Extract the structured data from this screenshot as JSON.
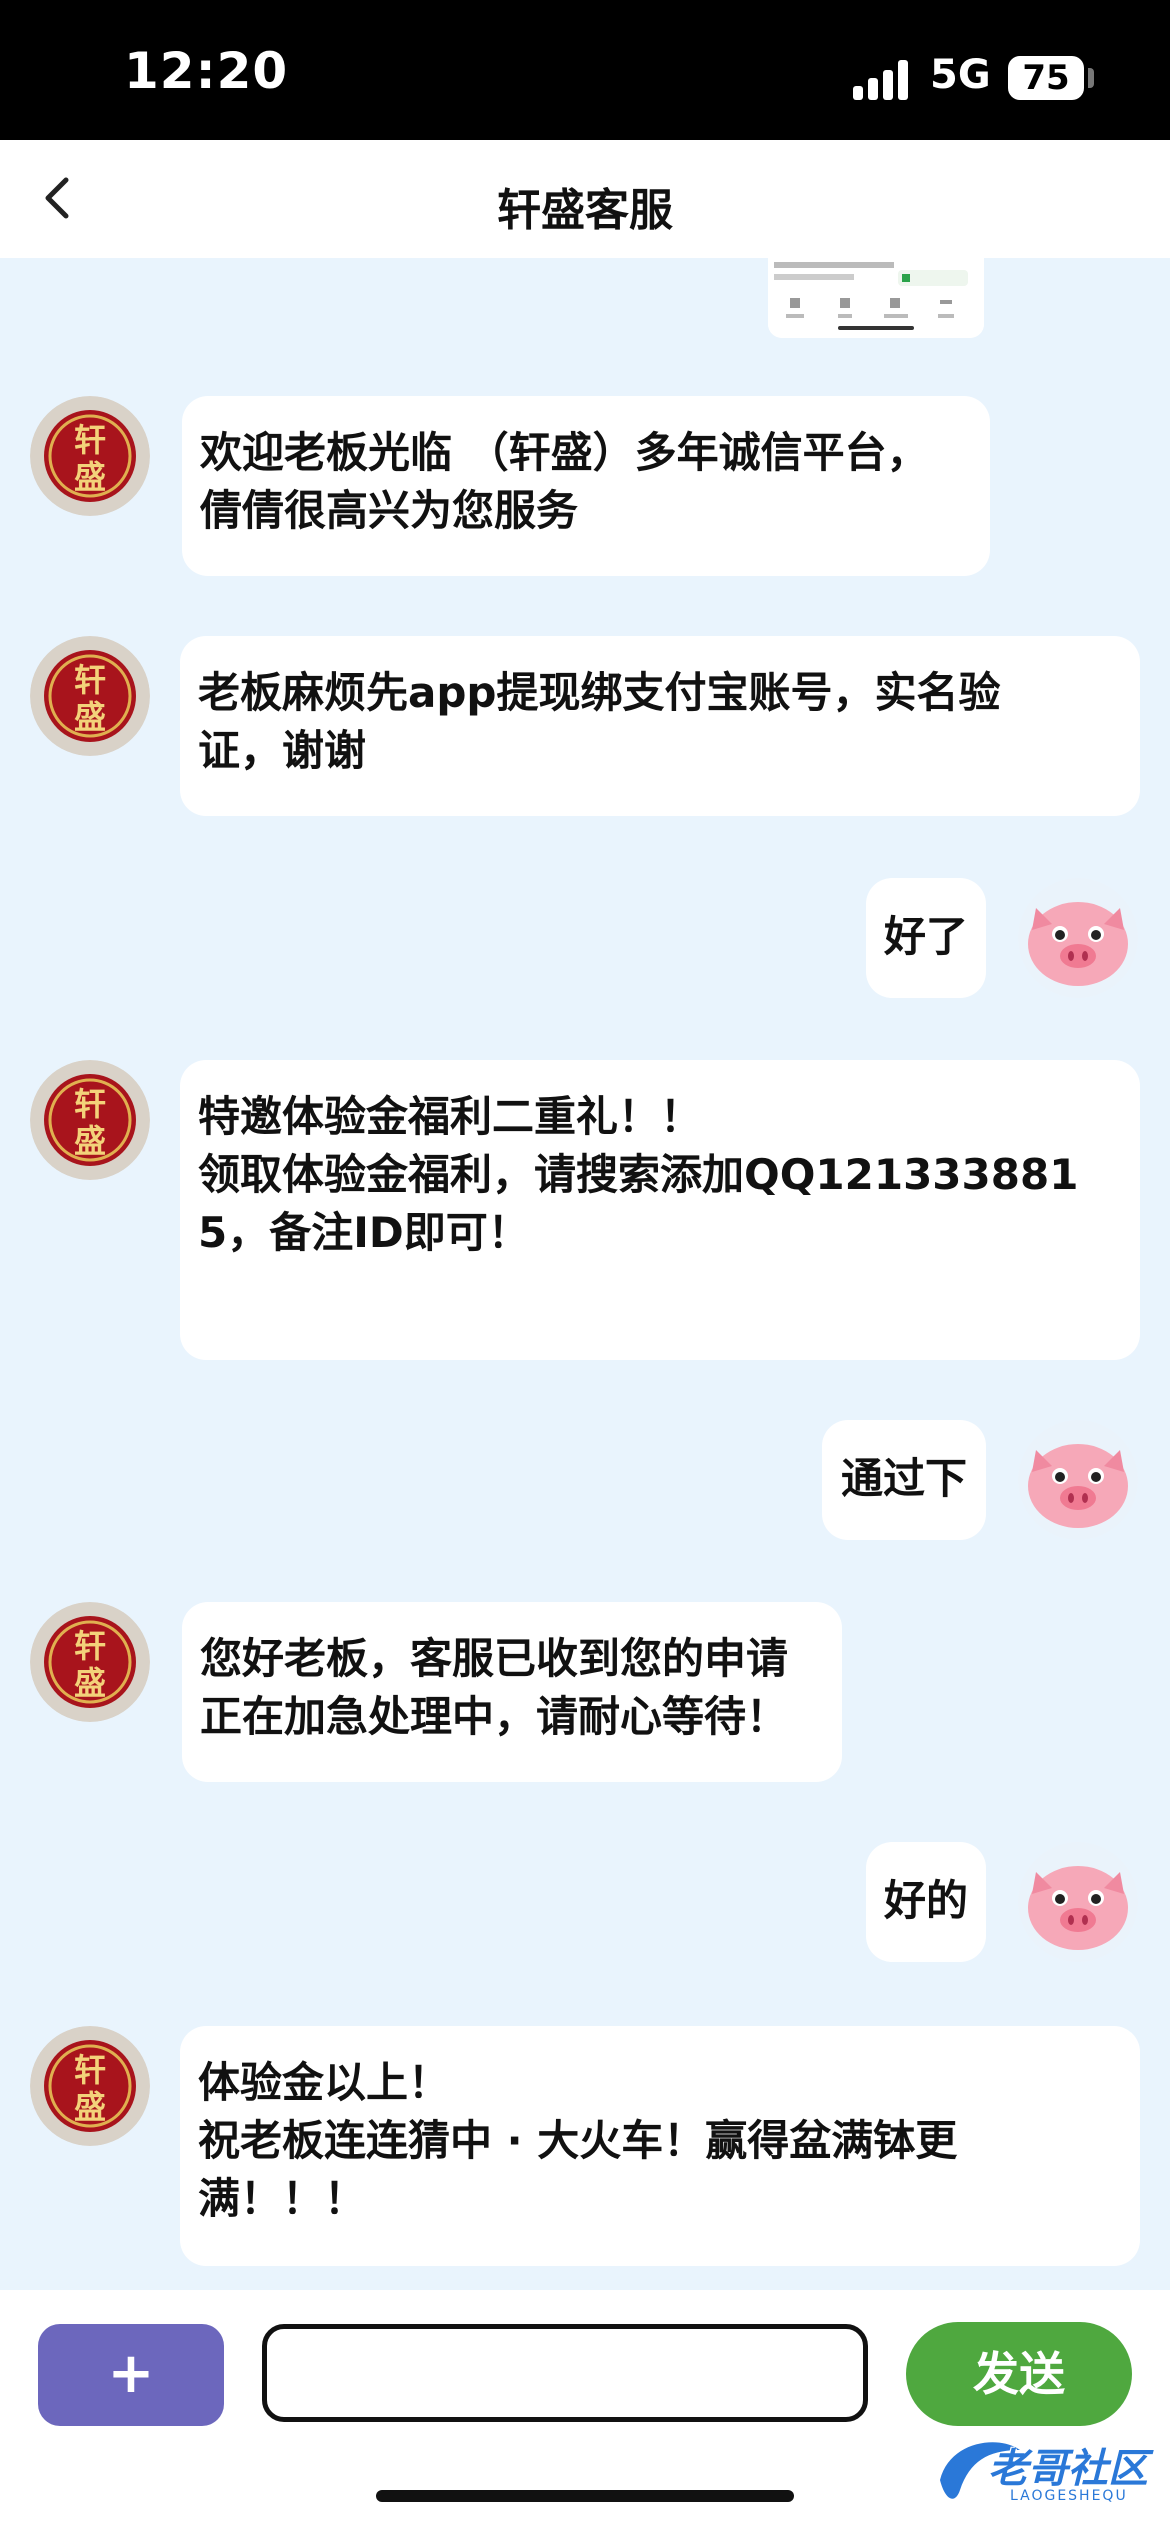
{
  "status_bar": {
    "time": "12:20",
    "network": "5G",
    "battery": "75"
  },
  "nav": {
    "title": "轩盛客服"
  },
  "avatar_text": "轩盛",
  "messages": [
    {
      "side": "left",
      "text": "欢迎老板光临 （轩盛）多年诚信平台，\n倩倩很高兴为您服务"
    },
    {
      "side": "left",
      "text": "老板麻烦先app提现绑支付宝账号，实名验\n证，谢谢"
    },
    {
      "side": "right",
      "text": "好了"
    },
    {
      "side": "left",
      "text": "特邀体验金福利二重礼！！\n领取体验金福利，请搜索添加QQ121333881\n5，备注ID即可！"
    },
    {
      "side": "right",
      "text": "通过下"
    },
    {
      "side": "left",
      "text": "您好老板，客服已收到您的申请\n正在加急处理中，请耐心等待！"
    },
    {
      "side": "right",
      "text": "好的"
    },
    {
      "side": "left",
      "text": "体验金以上！\n祝老板连连猜中 · 大火车！赢得盆满钵更\n满！！！"
    }
  ],
  "input_bar": {
    "plus_label": "+",
    "input_value": "",
    "send_label": "发送"
  },
  "watermark": {
    "text": "老哥社区",
    "sub": "LAOGESHEQU"
  },
  "colors": {
    "background": "#e9f4fd",
    "plus": "#6c67bd",
    "send": "#4fa83f"
  }
}
